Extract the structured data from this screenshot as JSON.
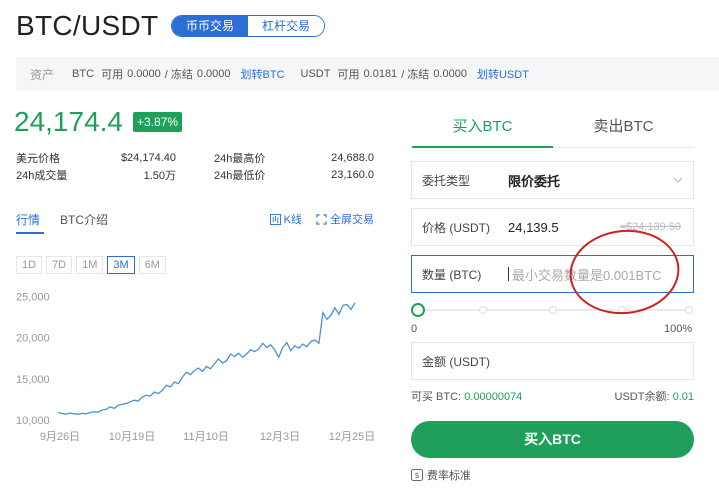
{
  "header": {
    "title": "BTC/USDT",
    "tabs": [
      {
        "label": "币币交易",
        "active": true
      },
      {
        "label": "杠杆交易",
        "active": false
      }
    ]
  },
  "assets": {
    "label": "资产",
    "btc": {
      "coin": "BTC",
      "available_label": "可用",
      "available": "0.0000",
      "frozen_label": "/ 冻结",
      "frozen": "0.0000",
      "transfer": "划转BTC"
    },
    "usdt": {
      "coin": "USDT",
      "available_label": "可用",
      "available": "0.0181",
      "frozen_label": "/ 冻结",
      "frozen": "0.0000",
      "transfer": "划转USDT"
    }
  },
  "ticker": {
    "price": "24,174.4",
    "change": "+3.87%",
    "stats": [
      {
        "label": "美元价格",
        "value": "$24,174.40",
        "label2": "24h最高价",
        "value2": "24,688.0"
      },
      {
        "label": "24h成交量",
        "value": "1.50万",
        "label2": "24h最低价",
        "value2": "23,160.0"
      }
    ]
  },
  "chart_tabs": {
    "tabs": [
      {
        "label": "行情",
        "active": true
      },
      {
        "label": "BTC介绍",
        "active": false
      }
    ],
    "kline": "K线",
    "fullscreen": "全屏交易"
  },
  "ranges": [
    {
      "label": "1D",
      "active": false
    },
    {
      "label": "7D",
      "active": false
    },
    {
      "label": "1M",
      "active": false
    },
    {
      "label": "3M",
      "active": true
    },
    {
      "label": "6M",
      "active": false
    }
  ],
  "chart_data": {
    "type": "line",
    "x": [
      "9月26日",
      "10月19日",
      "11月10日",
      "12月3日",
      "12月25日"
    ],
    "y_ticks": [
      "25,000",
      "20,000",
      "15,000",
      "10,000"
    ],
    "ylim": [
      10000,
      26000
    ],
    "grid": false,
    "series": [
      {
        "values": [
          10900,
          10800,
          10700,
          10850,
          10750,
          10700,
          10800,
          10750,
          10900,
          11000,
          10950,
          11200,
          11300,
          11600,
          11400,
          11800,
          11900,
          12000,
          12200,
          12400,
          12300,
          12800,
          13000,
          12900,
          13400,
          13200,
          13600,
          14200,
          14000,
          14600,
          14400,
          15200,
          15800,
          15500,
          16000,
          16300,
          15900,
          16500,
          16200,
          16800,
          17400,
          16900,
          17200,
          18000,
          17700,
          18100,
          17600,
          18000,
          18500,
          18300,
          18600,
          19300,
          18800,
          19100,
          18500,
          17600,
          18800,
          19400,
          18400,
          19000,
          18700,
          19200,
          18900,
          19500,
          19700,
          19300,
          23000,
          22200,
          22700,
          23600,
          22800,
          23900,
          24000,
          23400,
          24200
        ]
      }
    ],
    "color": "#4a90d9"
  },
  "order": {
    "tabs": [
      {
        "label": "买入BTC",
        "active": true
      },
      {
        "label": "卖出BTC",
        "active": false
      }
    ],
    "type_label": "委托类型",
    "type_value": "限价委托",
    "price_label": "价格 (USDT)",
    "price_value": "24,139.5",
    "price_hint": "≈$24,139.50",
    "qty_label": "数量 (BTC)",
    "qty_placeholder": "最小交易数量是0.001BTC",
    "slider_fraction": 0,
    "slider_min": "0",
    "slider_max": "100%",
    "amount_label": "金额 (USDT)",
    "avail_btc_label": "可买 BTC:",
    "avail_btc": "0.00000074",
    "usdt_balance_label": "USDT余额:",
    "usdt_balance": "0.01",
    "buy_button": "买入BTC",
    "fee_label": "费率标准"
  },
  "colors": {
    "accent": "#2b6fd6",
    "buy": "#1ea05a",
    "annotation": "#cc2222"
  }
}
